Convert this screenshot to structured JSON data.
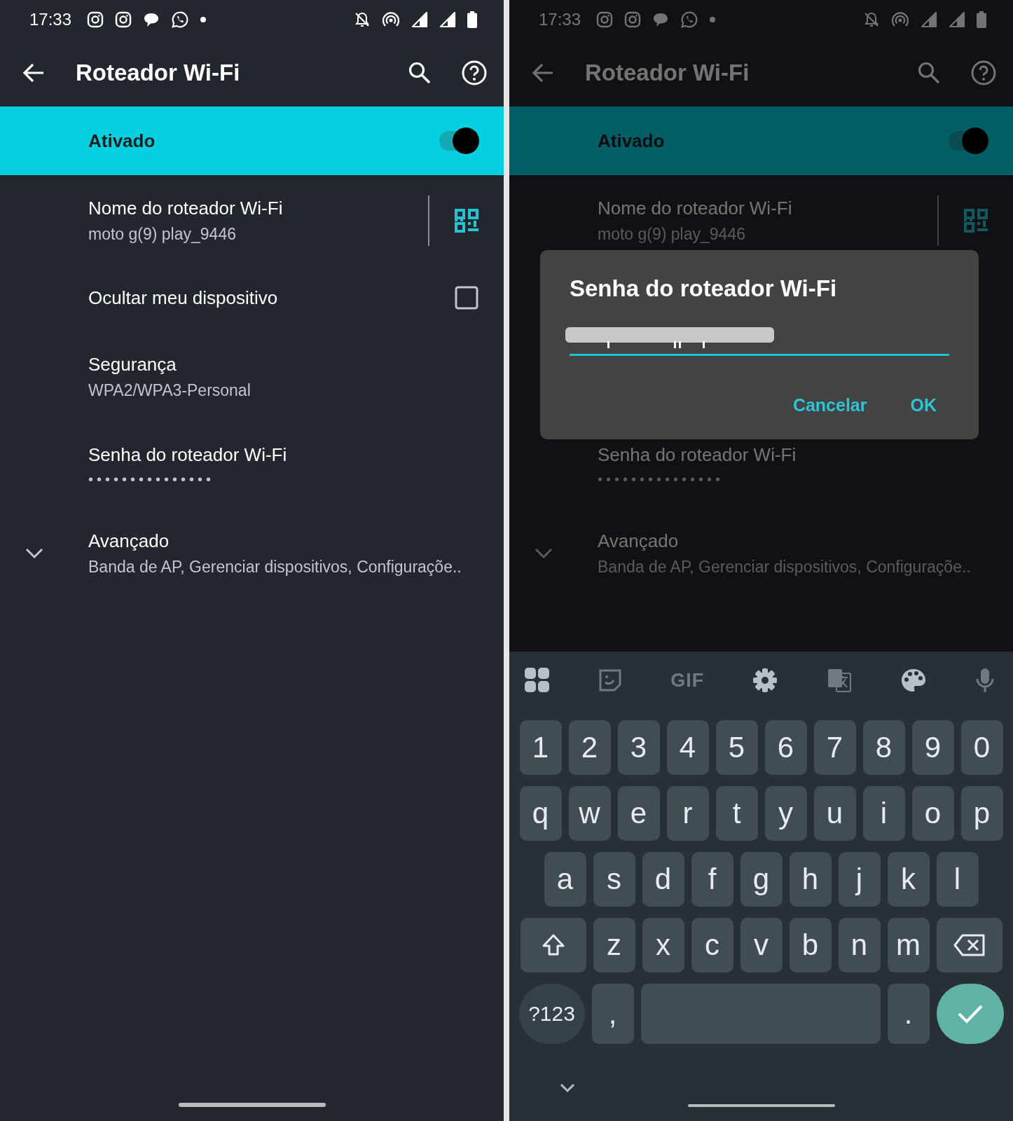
{
  "panes": [
    {
      "status_bar": {
        "time": "17:33"
      },
      "app_bar": {
        "title": "Roteador Wi-Fi"
      },
      "master_switch": {
        "label": "Ativado",
        "on": true
      },
      "dimmed": false,
      "settings": [
        {
          "kind": "qr",
          "title": "Nome do roteador Wi-Fi",
          "summary": "moto g(9) play_9446"
        },
        {
          "kind": "checkbox",
          "title": "Ocultar meu dispositivo",
          "checked": false
        },
        {
          "kind": "text",
          "title": "Segurança",
          "summary": "WPA2/WPA3-Personal"
        },
        {
          "kind": "password",
          "title": "Senha do roteador Wi-Fi",
          "summary": "•••••••••••••••"
        },
        {
          "kind": "expand",
          "title": "Avançado",
          "summary": "Banda de AP, Gerenciar dispositivos, Configuraçõe.."
        }
      ]
    },
    {
      "status_bar": {
        "time": "17:33"
      },
      "app_bar": {
        "title": "Roteador Wi-Fi"
      },
      "master_switch": {
        "label": "Ativado",
        "on": true
      },
      "dimmed": true,
      "settings": [
        {
          "kind": "qr",
          "title": "Nome do roteador Wi-Fi",
          "summary": "moto g(9) play_9446"
        },
        {
          "kind": "password",
          "title": "Senha do roteador Wi-Fi",
          "summary": "•••••••••••••••"
        },
        {
          "kind": "expand",
          "title": "Avançado",
          "summary": "Banda de AP, Gerenciar dispositivos, Configuraçõe.."
        }
      ],
      "dialog": {
        "title": "Senha do roteador Wi-Fi",
        "buttons": [
          "Cancelar",
          "OK"
        ]
      },
      "keyboard": {
        "toolbar": [
          {
            "kind": "grid"
          },
          {
            "kind": "sticker"
          },
          {
            "kind": "gif",
            "label": "GIF"
          },
          {
            "kind": "settings"
          },
          {
            "kind": "translate"
          },
          {
            "kind": "palette"
          },
          {
            "kind": "mic"
          }
        ],
        "rows": [
          {
            "keys": [
              "1",
              "2",
              "3",
              "4",
              "5",
              "6",
              "7",
              "8",
              "9",
              "0"
            ]
          },
          {
            "keys": [
              "q",
              "w",
              "e",
              "r",
              "t",
              "y",
              "u",
              "i",
              "o",
              "p"
            ]
          },
          {
            "keys": [
              "a",
              "s",
              "d",
              "f",
              "g",
              "h",
              "j",
              "k",
              "l"
            ]
          },
          {
            "keys": [
              {
                "kind": "shift"
              },
              "z",
              "x",
              "c",
              "v",
              "b",
              "n",
              "m",
              {
                "kind": "backspace"
              }
            ]
          },
          {
            "keys": [
              {
                "kind": "mode",
                "label": "?123"
              },
              {
                "kind": "char",
                "label": ","
              },
              {
                "kind": "space"
              },
              {
                "kind": "char",
                "label": "."
              },
              {
                "kind": "enter"
              }
            ]
          }
        ]
      }
    }
  ]
}
